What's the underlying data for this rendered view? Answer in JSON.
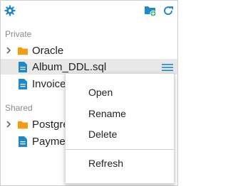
{
  "colors": {
    "accent": "#1e88c9",
    "folder": "#f39c12",
    "file": "#1e88c9",
    "add_badge": "#27ae60"
  },
  "toolbar": {
    "settings_icon": "gear-icon",
    "new_folder_icon": "folder-add-icon",
    "refresh_icon": "refresh-icon"
  },
  "sections": [
    {
      "title": "Private",
      "items": [
        {
          "type": "folder",
          "label": "Oracle"
        },
        {
          "type": "file",
          "label": "Album_DDL.sql"
        },
        {
          "type": "file",
          "label": "Invoice_"
        }
      ]
    },
    {
      "title": "Shared",
      "items": [
        {
          "type": "folder",
          "label": "Postgre"
        },
        {
          "type": "file",
          "label": "Paymen"
        }
      ]
    }
  ],
  "context_menu": {
    "open": "Open",
    "rename": "Rename",
    "delete": "Delete",
    "refresh": "Refresh"
  }
}
